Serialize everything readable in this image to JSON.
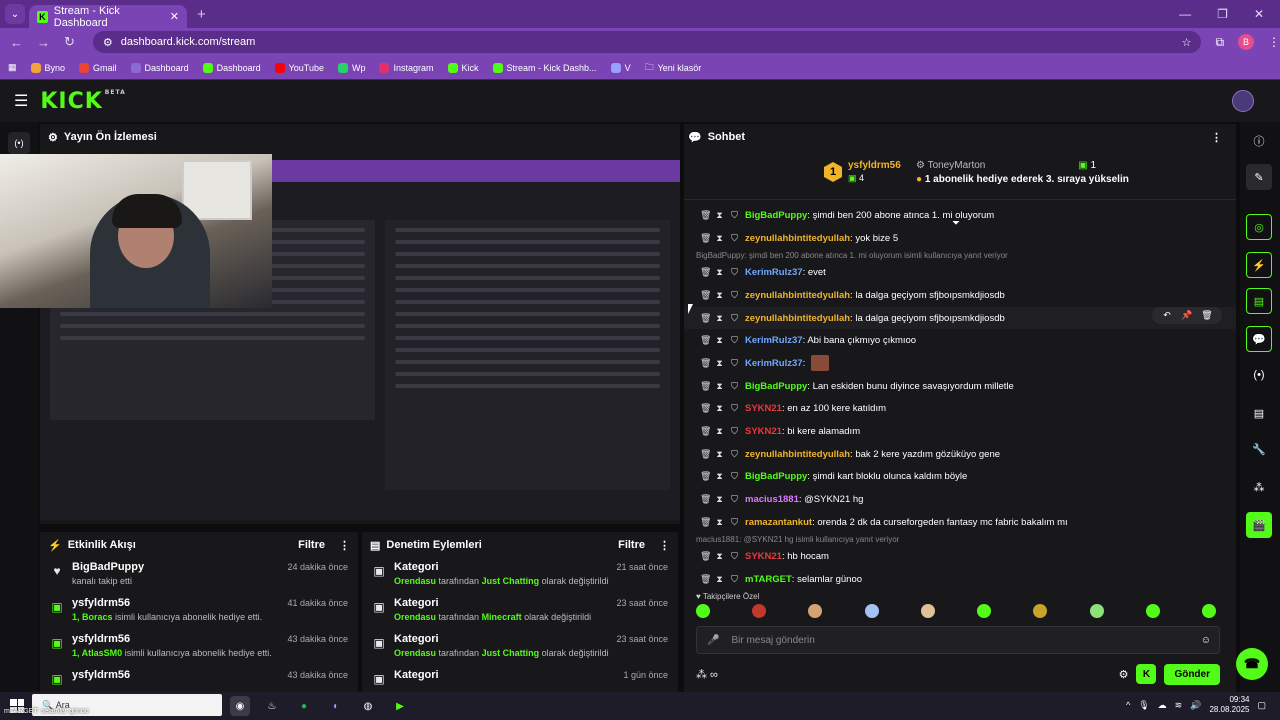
{
  "browser": {
    "tab_title": "Stream - Kick Dashboard",
    "url": "dashboard.kick.com/stream",
    "profile_initial": "B",
    "bookmarks": [
      "Byno",
      "Gmail",
      "Dashboard",
      "Dashboard",
      "YouTube",
      "Wp",
      "Instagram",
      "Kick",
      "Stream - Kick Dashb...",
      "V",
      "Yeni klasör"
    ]
  },
  "header": {
    "logo": "KICK",
    "beta": "BETA"
  },
  "left_rail": {
    "live_icon_label": "(•)"
  },
  "preview": {
    "title": "Yayın Ön İzlemesi"
  },
  "activity": {
    "title": "Etkinlik Akışı",
    "filter": "Filtre",
    "events": [
      {
        "name": "BigBadPuppy",
        "sub": "kanalı takip etti",
        "time": "24 dakika önce",
        "icon": "heart-icon"
      },
      {
        "name": "ysfyldrm56",
        "sub_hl": "1, Boracs",
        "sub": " isimli kullanıcıya abonelik hediye etti.",
        "time": "41 dakika önce",
        "icon": "gift-icon"
      },
      {
        "name": "ysfyldrm56",
        "sub_hl": "1, AtlasSM0",
        "sub": " isimli kullanıcıya abonelik hediye etti.",
        "time": "43 dakika önce",
        "icon": "gift-icon"
      },
      {
        "name": "ysfyldrm56",
        "sub_hl": "",
        "sub": "",
        "time": "43 dakika önce",
        "icon": "gift-icon"
      }
    ]
  },
  "moderation": {
    "title": "Denetim Eylemleri",
    "filter": "Filtre",
    "actions": [
      {
        "name": "Kategori",
        "by": "Orendasu",
        "mid": " tarafından ",
        "cat": "Just Chatting",
        "end": " olarak değiştirildi",
        "time": "21 saat önce"
      },
      {
        "name": "Kategori",
        "by": "Orendasu",
        "mid": " tarafından ",
        "cat": "Minecraft",
        "end": " olarak değiştirildi",
        "time": "23 saat önce"
      },
      {
        "name": "Kategori",
        "by": "Orendasu",
        "mid": " tarafından ",
        "cat": "Just Chatting",
        "end": " olarak değiştirildi",
        "time": "23 saat önce"
      },
      {
        "name": "Kategori",
        "by": "",
        "mid": "",
        "cat": "",
        "end": "",
        "time": "1 gün önce"
      }
    ]
  },
  "chat": {
    "title": "Sohbet",
    "pinned": {
      "rank": "1",
      "user": "ysfyldrm56",
      "count": "4",
      "user2": "ToneyMarton",
      "message": "1 abonelik hediye ederek 3. sıraya yükselin",
      "count2": "1"
    },
    "messages": [
      {
        "user": "BigBadPuppy",
        "color": "#53fc18",
        "text": "şimdi ben 200 abone atınca 1. mi oluyorum"
      },
      {
        "user": "zeynullahbintitedyullah",
        "color": "#f0b429",
        "text": "yok bize 5"
      },
      {
        "reply": "BigBadPuppy: şimdi ben 200 abone atınca 1. mi oluyorum isimli kullanıcıya yanıt veriyor"
      },
      {
        "user": "KerimRulz37",
        "color": "#6fa8ff",
        "text": "evet"
      },
      {
        "user": "zeynullahbintitedyullah",
        "color": "#f0b429",
        "text": "la dalga geçiyom sfjboıpsmkdjiosdb"
      },
      {
        "user": "zeynullahbintitedyullah",
        "color": "#f0b429",
        "text": "la dalga geçiyom sfjboıpsmkdjiosdb",
        "hover": true
      },
      {
        "user": "KerimRulz37",
        "color": "#6fa8ff",
        "text": "Abi bana çıkmıyo çıkmıoo"
      },
      {
        "user": "KerimRulz37",
        "color": "#6fa8ff",
        "text": "",
        "thumb": true
      },
      {
        "user": "BigBadPuppy",
        "color": "#53fc18",
        "text": "Lan eskiden bunu diyince savaşıyordum milletle"
      },
      {
        "user": "SYKN21",
        "color": "#e8383d",
        "text": "en az 100 kere katıldım"
      },
      {
        "user": "SYKN21",
        "color": "#e8383d",
        "text": "bi kere alamadım"
      },
      {
        "user": "zeynullahbintitedyullah",
        "color": "#f0b429",
        "text": "bak 2 kere yazdım gözüküyo gene"
      },
      {
        "user": "BigBadPuppy",
        "color": "#53fc18",
        "text": "şimdi kart bloklu olunca kaldım böyle"
      },
      {
        "user": "macius1881",
        "color": "#d97bff",
        "text": "@SYKN21 hg"
      },
      {
        "user": "ramazantankut",
        "color": "#f0b429",
        "text": "orenda 2 dk da curseforgeden fantasy mc fabric bakalım mı"
      },
      {
        "reply": "macius1881: @SYKN21 hg isimli kullanıcıya yanıt veriyor"
      },
      {
        "user": "SYKN21",
        "color": "#e8383d",
        "text": "hb hocam"
      },
      {
        "user": "mTARGET",
        "color": "#53fc18",
        "text": "selamlar günoo"
      }
    ],
    "followers_only": "Takipçilere Özel",
    "input_placeholder": "Bir mesaj gönderin",
    "send": "Gönder"
  },
  "taskbar": {
    "search_placeholder": "Ara",
    "overlay_text": "mTARGET: selamlar günoo",
    "time": "09:34",
    "date": "28.08.2025"
  },
  "colors": {
    "kick_green": "#53fc18",
    "browser_purple": "#7a44b5",
    "panel_bg": "#18181b"
  }
}
